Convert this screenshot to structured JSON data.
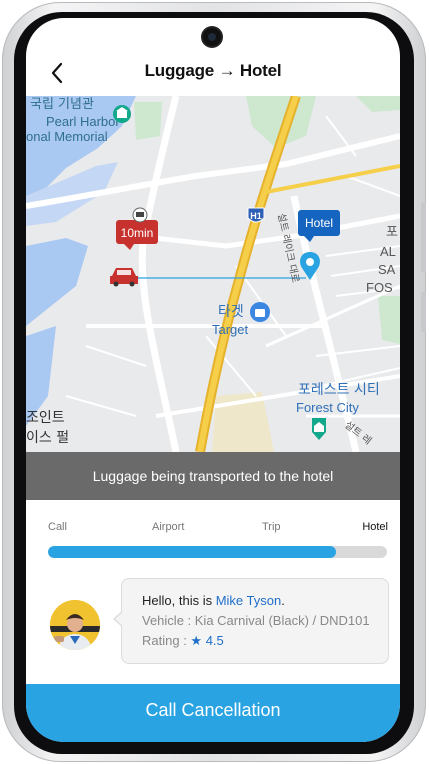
{
  "header": {
    "title": "Luggage → Hotel",
    "back_icon": "chevron-left-icon"
  },
  "map": {
    "labels": {
      "memorial_korean": "국립 기념관",
      "memorial_line1": "Pearl Harbor",
      "memorial_line2": "onal Memorial",
      "highway": "H1",
      "road_vertical": "설트 레이크 대로",
      "target_korean": "타겟",
      "target": "Target",
      "forest_korean": "포레스트 시티",
      "forest": "Forest City",
      "bottom_left_1": "조인트",
      "bottom_left_2": "이스 펄",
      "right_edge_1": "포",
      "right_edge_2": "AL",
      "right_edge_3": "SA",
      "right_edge_4": "FOS",
      "road_bottom": "설트 레"
    },
    "car_marker": {
      "eta": "10min",
      "icon": "car-icon"
    },
    "hotel_marker": {
      "label": "Hotel",
      "icon": "location-pin-icon"
    },
    "colors": {
      "water": "#a9c8f2",
      "land": "#e9eaec",
      "park": "#cde8cf",
      "highway": "#f3c43b",
      "car_marker": "#c8322e",
      "hotel_marker": "#1565c0"
    }
  },
  "status": {
    "text": "Luggage being transported to the hotel"
  },
  "progress": {
    "steps": [
      "Call",
      "Airport",
      "Trip",
      "Hotel"
    ],
    "active_step": "Hotel",
    "value_percent": 85,
    "color": "#29a3e2"
  },
  "driver": {
    "greeting_prefix": "Hello, this is ",
    "name": "Mike Tyson",
    "greeting_suffix": ".",
    "vehicle_label": "Vehicle : ",
    "vehicle": "Kia Carnival (Black) / DND101",
    "rating_label": "Rating : ",
    "rating_star": "★",
    "rating": "4.5",
    "avatar_icon": "driver-avatar"
  },
  "action": {
    "label": "Call Cancellation",
    "color": "#29a3e2"
  }
}
